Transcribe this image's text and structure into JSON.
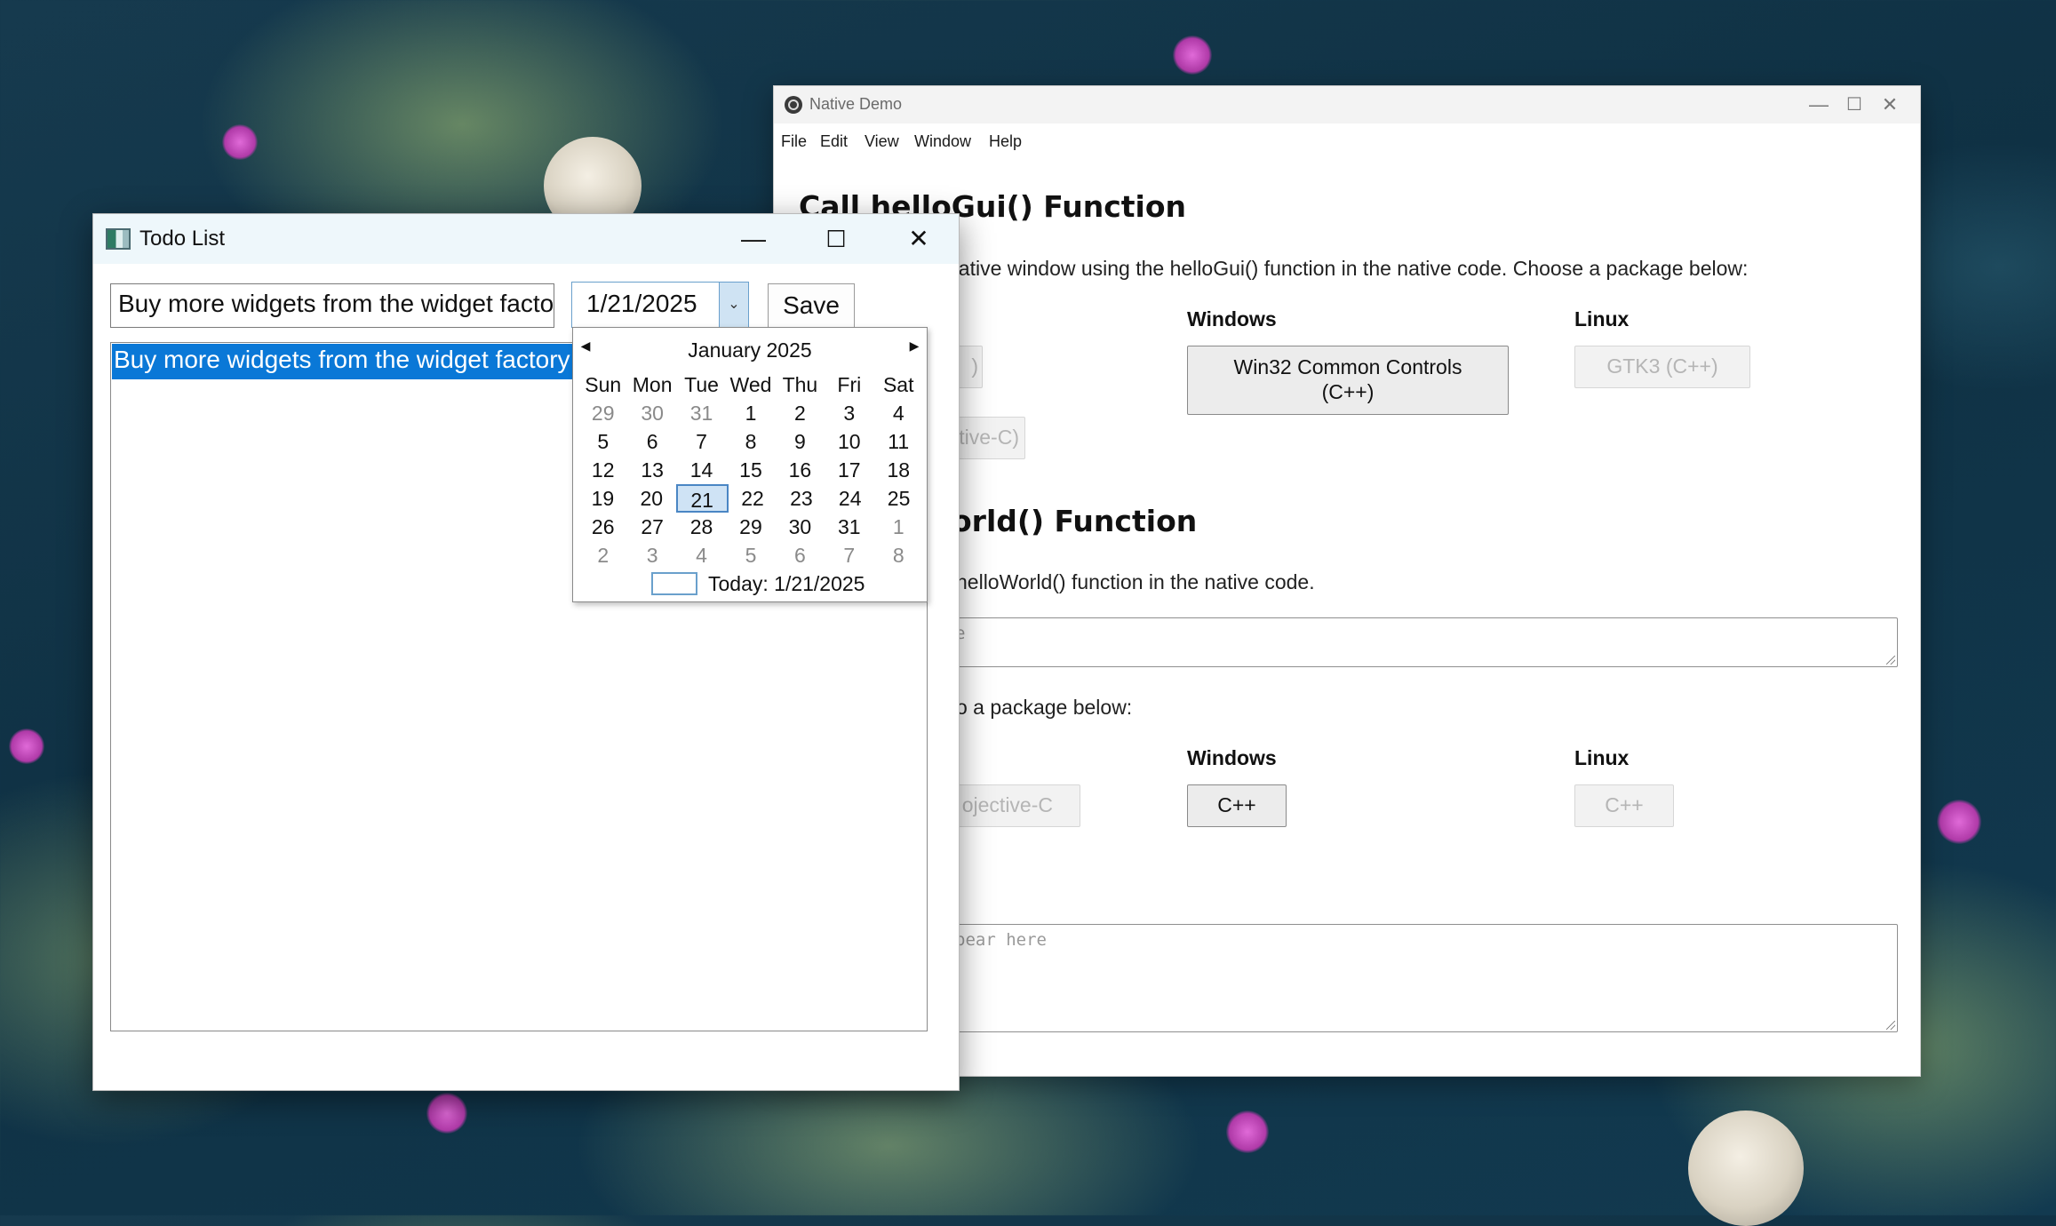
{
  "native_demo": {
    "title": "Native Demo",
    "controls": {
      "minimize": "—",
      "maximize": "☐",
      "close": "✕"
    },
    "menu": [
      "File",
      "Edit",
      "View",
      "Window",
      "Help"
    ],
    "section1": {
      "heading": "Call helloGui() Function",
      "desc": "native window using the helloGui() function in the native code. Choose a package below:",
      "col_windows": "Windows",
      "col_linux": "Linux",
      "btn_mac_partial_1": ")",
      "btn_mac_partial_2": "tive-C)",
      "btn_win32": "Win32 Common Controls (C++)",
      "btn_gtk3": "GTK3 (C++)"
    },
    "section2": {
      "heading": "orld() Function",
      "desc": "helloWorld() function in the native code.",
      "textarea_hint": "e",
      "desc2": "o a package below:",
      "col_windows": "Windows",
      "col_linux": "Linux",
      "btn_mac_partial": "ojective-C",
      "btn_win_cpp": "C++",
      "btn_linux_cpp": "C++",
      "output_placeholder": "pear here"
    }
  },
  "todo": {
    "title": "Todo List",
    "controls": {
      "minimize": "—",
      "maximize": "☐",
      "close": "✕"
    },
    "input_value": "Buy more widgets from the widget factory",
    "date_value": "1/21/2025",
    "save_label": "Save",
    "items": [
      "Buy more widgets from the widget factory"
    ],
    "calendar": {
      "month_label": "January 2025",
      "weekdays": [
        "Sun",
        "Mon",
        "Tue",
        "Wed",
        "Thu",
        "Fri",
        "Sat"
      ],
      "weeks": [
        [
          "29",
          "30",
          "31",
          "1",
          "2",
          "3",
          "4"
        ],
        [
          "5",
          "6",
          "7",
          "8",
          "9",
          "10",
          "11"
        ],
        [
          "12",
          "13",
          "14",
          "15",
          "16",
          "17",
          "18"
        ],
        [
          "19",
          "20",
          "21",
          "22",
          "23",
          "24",
          "25"
        ],
        [
          "26",
          "27",
          "28",
          "29",
          "30",
          "31",
          "1"
        ],
        [
          "2",
          "3",
          "4",
          "5",
          "6",
          "7",
          "8"
        ]
      ],
      "selected_day": "21",
      "today_label": "Today: 1/21/2025"
    }
  }
}
